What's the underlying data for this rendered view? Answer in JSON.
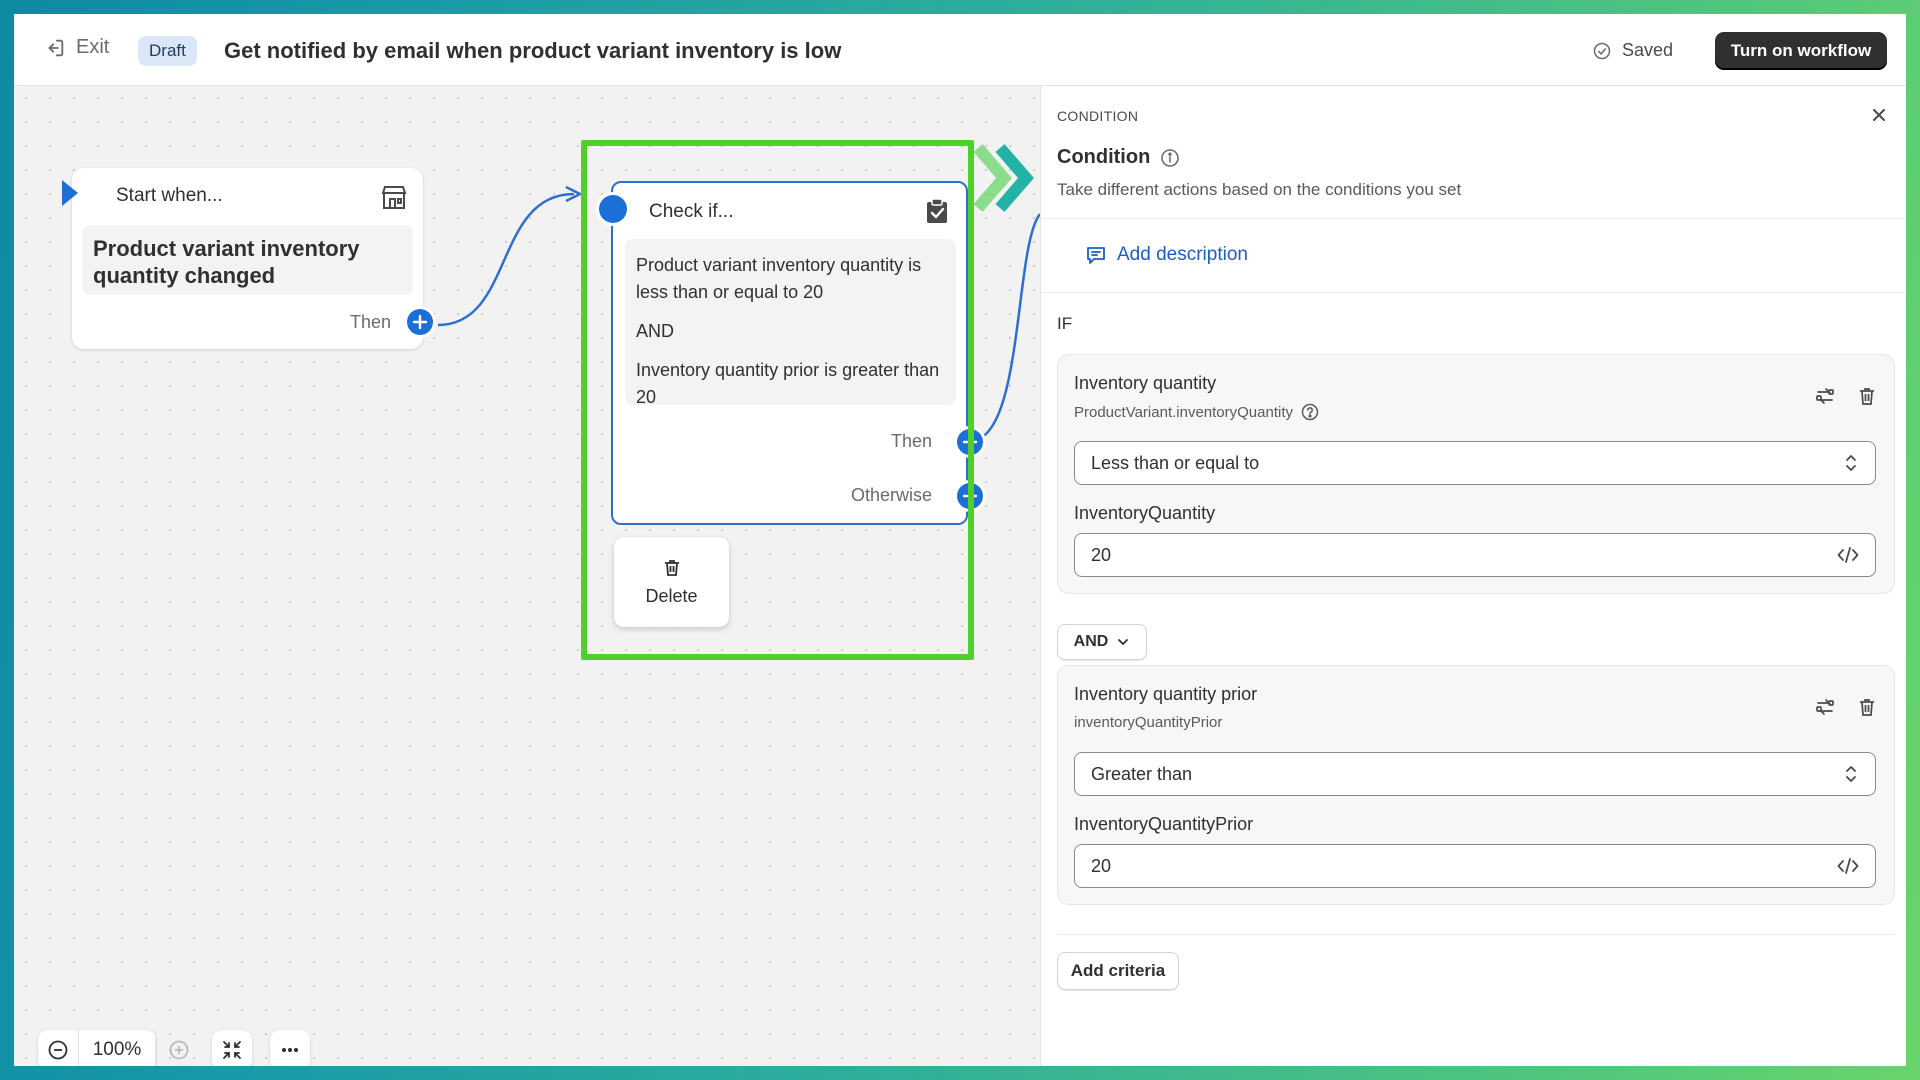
{
  "topbar": {
    "exit_label": "Exit",
    "status_badge": "Draft",
    "workflow_title": "Get notified by email when product variant inventory is low",
    "saved_label": "Saved",
    "turn_on_label": "Turn on workflow"
  },
  "canvas": {
    "start_node": {
      "label": "Start when...",
      "trigger": "Product variant inventory quantity changed",
      "then_label": "Then",
      "icon": "store-icon"
    },
    "check_node": {
      "label": "Check if...",
      "condition_1": "Product variant inventory quantity is less than or equal to 20",
      "operator": "AND",
      "condition_2": "Inventory quantity prior is greater than 20",
      "then_label": "Then",
      "otherwise_label": "Otherwise",
      "icon": "clipboard-check-icon"
    },
    "delete_popover": {
      "label": "Delete",
      "icon": "trash-icon"
    },
    "zoom": {
      "value": "100%"
    }
  },
  "panel": {
    "eyebrow": "CONDITION",
    "title": "Condition",
    "subtitle": "Take different actions based on the conditions you set",
    "add_description_label": "Add description",
    "if_label": "IF",
    "criteria": [
      {
        "name": "Inventory quantity",
        "path": "ProductVariant.inventoryQuantity",
        "operator": "Less than or equal to",
        "value_label": "InventoryQuantity",
        "value": "20"
      },
      {
        "name": "Inventory quantity prior",
        "path": "inventoryQuantityPrior",
        "operator": "Greater than",
        "value_label": "InventoryQuantityPrior",
        "value": "20"
      }
    ],
    "join_operator": "AND",
    "add_criteria_label": "Add criteria"
  },
  "colors": {
    "accent_blue": "#1c6fd6",
    "highlight_green": "#4fcf2a",
    "primary_button": "#303030",
    "link_blue": "#1c5fc0"
  }
}
